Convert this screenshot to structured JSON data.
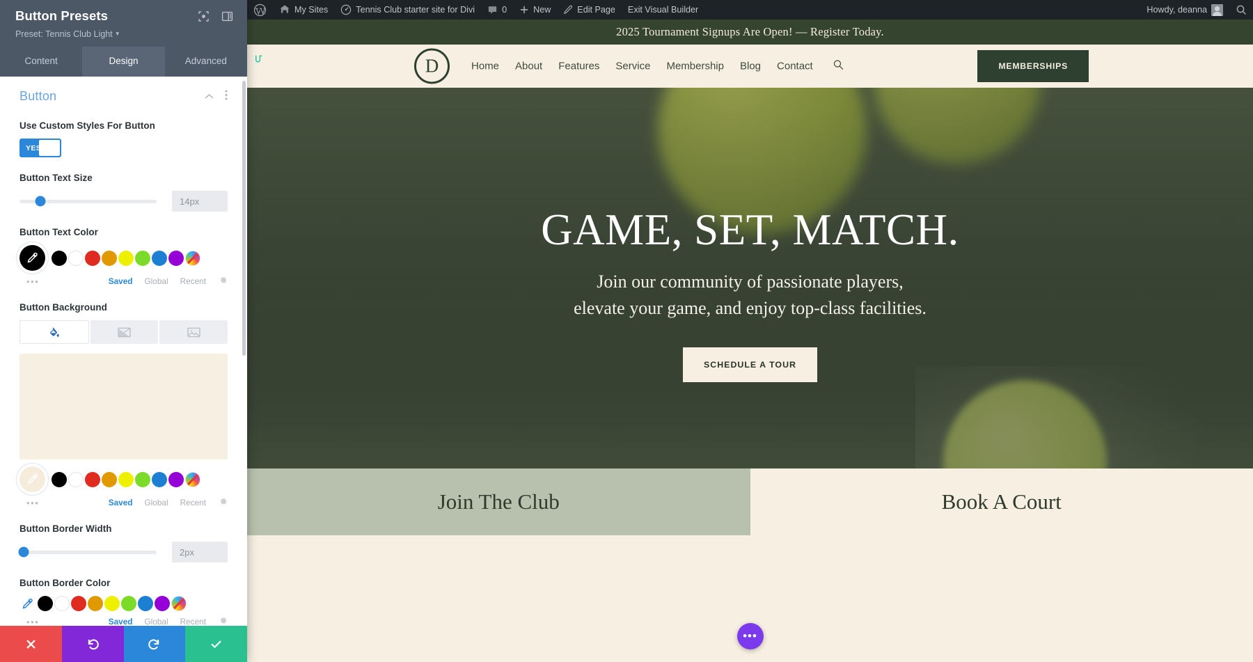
{
  "panel": {
    "title": "Button Presets",
    "preset_label": "Preset: Tennis Club Light",
    "header_icons": [
      {
        "name": "focus-icon"
      },
      {
        "name": "layout-icon"
      }
    ],
    "tabs": [
      {
        "label": "Content",
        "active": false
      },
      {
        "label": "Design",
        "active": true
      },
      {
        "label": "Advanced",
        "active": false
      }
    ],
    "section": {
      "title": "Button",
      "fields": {
        "custom_styles": {
          "label": "Use Custom Styles For Button",
          "toggle_value": "YES"
        },
        "text_size": {
          "label": "Button Text Size",
          "value": "14px",
          "slider_percent": 15
        },
        "text_color": {
          "label": "Button Text Color",
          "selected": "#000000",
          "swatches": [
            "#000000",
            "#ffffff",
            "#e02b20",
            "#e09900",
            "#edf000",
            "#7cdb29",
            "#1c7fd1",
            "#9500d6"
          ],
          "meta": {
            "dots": "•••",
            "saved": "Saved",
            "global": "Global",
            "recent": "Recent",
            "active": "Saved"
          }
        },
        "background": {
          "label": "Button Background",
          "tabs": [
            {
              "name": "color-fill-tab",
              "active": true
            },
            {
              "name": "gradient-tab",
              "active": false
            },
            {
              "name": "image-tab",
              "active": false
            }
          ],
          "preview_color": "#f7efe2",
          "swatches": [
            "#000000",
            "#ffffff",
            "#e02b20",
            "#e09900",
            "#edf000",
            "#7cdb29",
            "#1c7fd1",
            "#9500d6"
          ],
          "meta": {
            "dots": "•••",
            "saved": "Saved",
            "global": "Global",
            "recent": "Recent",
            "active": "Saved"
          }
        },
        "border_width": {
          "label": "Button Border Width",
          "value": "2px",
          "slider_percent": 2
        },
        "border_color": {
          "label": "Button Border Color",
          "swatches": [
            "#000000",
            "#ffffff",
            "#e02b20",
            "#e09900",
            "#edf000",
            "#7cdb29",
            "#1c7fd1",
            "#9500d6"
          ],
          "meta": {
            "dots": "•••",
            "saved": "Saved",
            "global": "Global",
            "recent": "Recent",
            "active": "Saved"
          }
        }
      }
    },
    "actions": [
      {
        "name": "close-button",
        "color": "#ec4b4b"
      },
      {
        "name": "undo-button",
        "color": "#8228d9"
      },
      {
        "name": "redo-button",
        "color": "#2b87da"
      },
      {
        "name": "save-button",
        "color": "#2ac08f"
      }
    ]
  },
  "adminbar": {
    "wp_logo": "wordpress-logo-icon",
    "my_sites": "My Sites",
    "site_name": "Tennis Club starter site for Divi",
    "comments_count": "0",
    "new_label": "New",
    "edit_page": "Edit Page",
    "exit_builder": "Exit Visual Builder",
    "howdy": "Howdy, deanna"
  },
  "site": {
    "promo": "2025 Tournament Signups Are Open! — Register Today.",
    "logo_letter": "D",
    "nav": [
      "Home",
      "About",
      "Features",
      "Service",
      "Membership",
      "Blog",
      "Contact"
    ],
    "cta": "MEMBERSHIPS",
    "hero": {
      "title": "GAME, SET, MATCH.",
      "subtitle_line1": "Join our community of passionate players,",
      "subtitle_line2": "elevate your game, and enjoy top-class facilities.",
      "button": "SCHEDULE A TOUR"
    },
    "split": {
      "left": "Join The Club",
      "right": "Book A Court"
    },
    "fab": "•••"
  }
}
